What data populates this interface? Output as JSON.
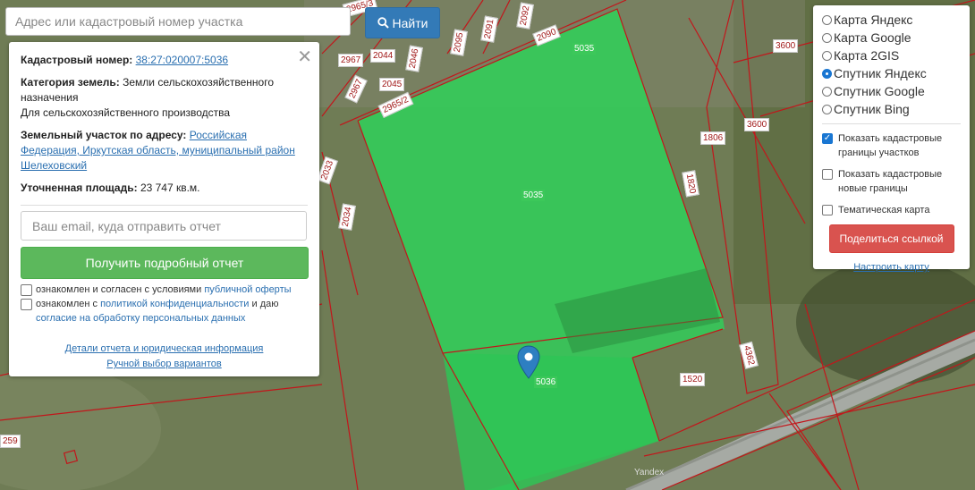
{
  "search": {
    "placeholder": "Адрес или кадастровый номер участка",
    "button_label": "Найти"
  },
  "panel": {
    "cadastral_label": "Кадастровый номер:",
    "cadastral_value": "38:27:020007:5036",
    "category_label": "Категория земель:",
    "category_value": "Земли сельскохозяйственного назначения",
    "category_usage": "Для сельскохозяйственного производства",
    "address_label": "Земельный участок по адресу:",
    "address_value": "Российская Федерация, Иркутская область, муниципальный район Шелеховский",
    "area_label": "Уточненная площадь:",
    "area_value": "23 747 кв.м.",
    "email_placeholder": "Ваш email, куда отправить отчет",
    "report_button": "Получить подробный отчет",
    "offer_text": "ознакомлен и согласен с условиями",
    "offer_link": "публичной оферты",
    "privacy_text": "ознакомлен с",
    "privacy_link": "политикой конфиденциальности",
    "privacy_and": "и даю",
    "consent_link": "согласие на обработку персональных данных",
    "details_link": "Детали отчета и юридическая информация",
    "manual_link": "Ручной выбор вариантов"
  },
  "layers": {
    "options": [
      {
        "label": "Карта Яндекс",
        "selected": false
      },
      {
        "label": "Карта Google",
        "selected": false
      },
      {
        "label": "Карта 2GIS",
        "selected": false
      },
      {
        "label": "Спутник Яндекс",
        "selected": true
      },
      {
        "label": "Спутник Google",
        "selected": false
      },
      {
        "label": "Спутник Bing",
        "selected": false
      }
    ],
    "show_borders": "Показать кадастровые границы участков",
    "show_new": "Показать кадастровые новые границы",
    "thematic": "Тематическая карта",
    "share_button": "Поделиться ссылкой",
    "configure_link": "Настроить карту"
  },
  "map": {
    "labels": {
      "p5035a": "5035",
      "p5035b": "5035",
      "p5036": "5036",
      "p1520": "1520",
      "p1806": "1806",
      "p1820": "1820",
      "p4362": "4362",
      "p3600a": "3600",
      "p3600b": "3600",
      "p2967": "2967",
      "p2044": "2044",
      "p2046": "2046",
      "p2095": "2095",
      "p2091": "2091",
      "p2092": "2092",
      "p2090": "2090",
      "p2045": "2045",
      "p2965": "2965/2",
      "p2033": "2033",
      "p2034": "2034",
      "p2967b": "2967",
      "p259": "259",
      "p2965t": "2965/3"
    },
    "watermark": "Yandex"
  }
}
